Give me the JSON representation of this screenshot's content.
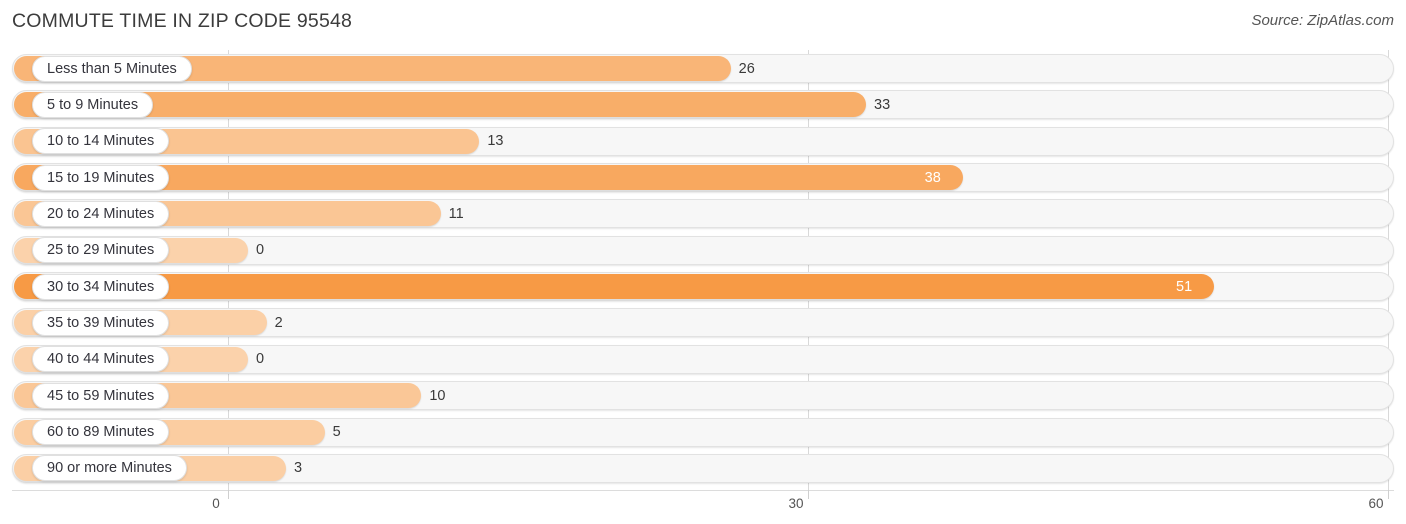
{
  "header": {
    "title": "COMMUTE TIME IN ZIP CODE 95548",
    "source": "Source: ZipAtlas.com"
  },
  "colors": {
    "bar_max": "#F79A45",
    "bar_min": "#FBD2AB",
    "track_fill": "#F7F7F7",
    "track_border": "#E2E2E2",
    "gridline": "#D9D9D9",
    "label_text": "#34343C",
    "value_text": "#3A3A3A",
    "value_text_inside": "#FFFFFF",
    "title_text": "#3C3C3C",
    "source_text": "#555555"
  },
  "chart_data": {
    "type": "bar",
    "orientation": "horizontal",
    "title": "COMMUTE TIME IN ZIP CODE 95548",
    "xlabel": "",
    "ylabel": "",
    "xlim": [
      0,
      60
    ],
    "grid": true,
    "legend": null,
    "xticks": [
      "0",
      "30",
      "60"
    ],
    "xtick_values": [
      0,
      30,
      60
    ],
    "categories": [
      "Less than 5 Minutes",
      "5 to 9 Minutes",
      "10 to 14 Minutes",
      "15 to 19 Minutes",
      "20 to 24 Minutes",
      "25 to 29 Minutes",
      "30 to 34 Minutes",
      "35 to 39 Minutes",
      "40 to 44 Minutes",
      "45 to 59 Minutes",
      "60 to 89 Minutes",
      "90 or more Minutes"
    ],
    "values": [
      26,
      33,
      13,
      38,
      11,
      0,
      51,
      2,
      0,
      10,
      5,
      3
    ],
    "value_labels": [
      "26",
      "33",
      "13",
      "38",
      "11",
      "0",
      "51",
      "2",
      "0",
      "10",
      "5",
      "3"
    ],
    "label_inside": [
      false,
      false,
      false,
      true,
      false,
      false,
      true,
      false,
      false,
      false,
      false,
      false
    ]
  }
}
